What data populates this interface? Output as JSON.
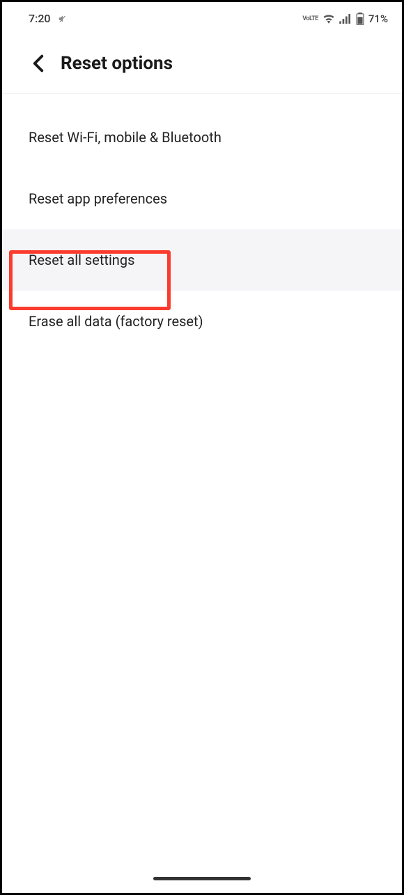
{
  "status_bar": {
    "time": "7:20",
    "lte_label": "VoLTE",
    "battery_percent": "71%"
  },
  "header": {
    "title": "Reset options"
  },
  "options": [
    {
      "label": "Reset Wi-Fi, mobile & Bluetooth"
    },
    {
      "label": "Reset app preferences"
    },
    {
      "label": "Reset all settings"
    },
    {
      "label": "Erase all data (factory reset)"
    }
  ]
}
